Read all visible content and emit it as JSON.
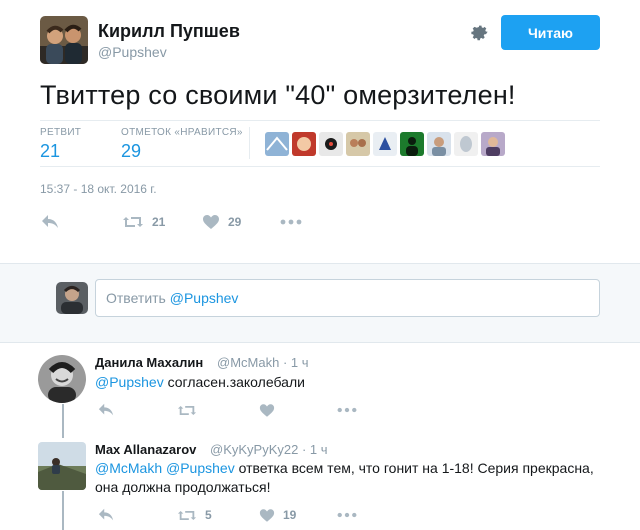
{
  "tweet": {
    "author_name": "Кирилл Пупшев",
    "author_handle": "@Pupshev",
    "follow_label": "Читаю",
    "text": "Твиттер со своими \"40\" омерзителен!",
    "stats": {
      "retweets_label": "РЕТВИТ",
      "retweets": "21",
      "likes_label": "ОТМЕТОК «НРАВИТСЯ»",
      "likes": "29"
    },
    "timestamp": "15:37 - 18 окт. 2016 г.",
    "actions": {
      "retweet_count": "21",
      "like_count": "29"
    }
  },
  "reply_box": {
    "prefix": "Ответить ",
    "mention": "@Pupshev"
  },
  "replies": [
    {
      "name": "Данила Махалин",
      "handle": "@McMakh",
      "time": "· 1 ч",
      "mention": "@Pupshev",
      "text": " согласен.заколебали",
      "retweet_count": "",
      "like_count": ""
    },
    {
      "name": "Max Allanazarov",
      "handle": "@KyKyPyKy22",
      "time": "· 1 ч",
      "mention1": "@McMakh",
      "mention2": "@Pupshev",
      "text": " ответка всем тем, что гонит на 1-18! Серия прекрасна, она должна продолжаться!",
      "retweet_count": "5",
      "like_count": "19"
    }
  ],
  "colors": {
    "accent": "#1da1f2",
    "link": "#1b95e0",
    "muted": "#8899a6"
  },
  "icons": [
    "gear-icon",
    "reply-icon",
    "retweet-icon",
    "heart-icon",
    "more-icon"
  ]
}
